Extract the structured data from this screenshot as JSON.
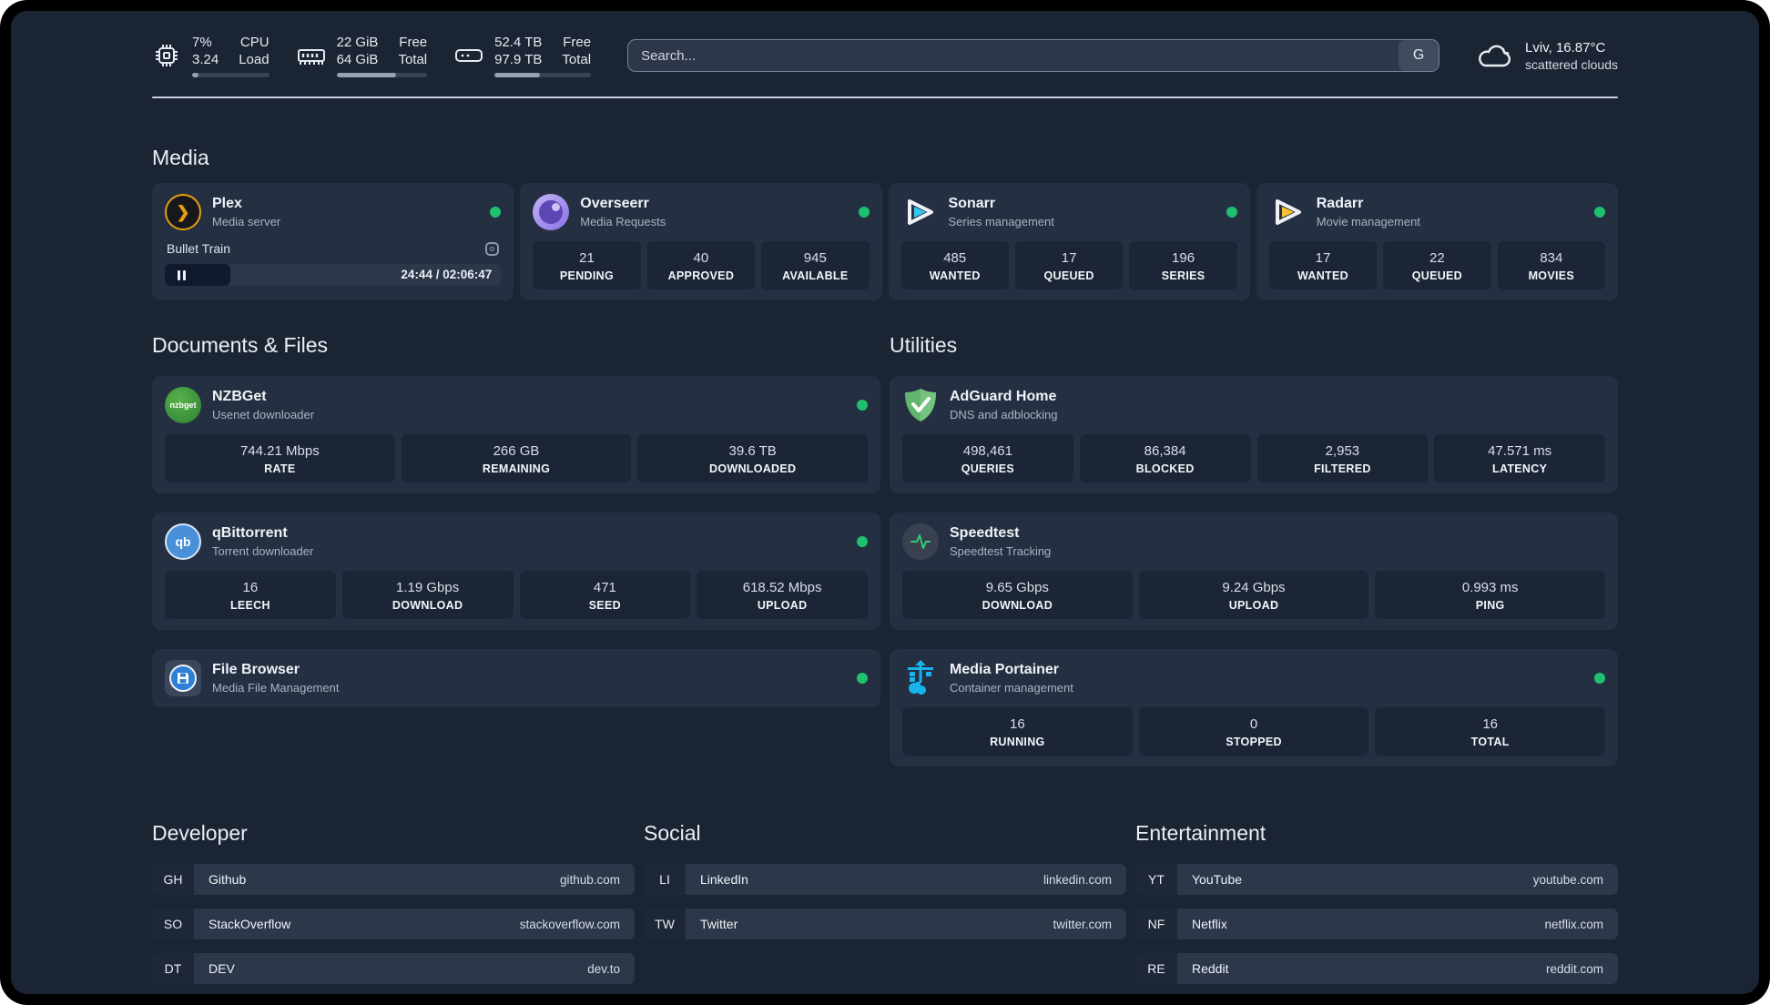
{
  "colors": {
    "online": "#1fc06e",
    "plex_accent": "#e5a00d",
    "sonarr_accent": "#35c5f4",
    "radarr_accent": "#ffc230",
    "portainer_accent": "#18b3e8",
    "speedtest_accent": "#2ecc71"
  },
  "header": {
    "metrics": [
      {
        "icon": "cpu-icon",
        "value1": "7%",
        "value2": "3.24",
        "label1": "CPU",
        "label2": "Load",
        "progress_pct": 8
      },
      {
        "icon": "ram-icon",
        "value1": "22 GiB",
        "value2": "64 GiB",
        "label1": "Free",
        "label2": "Total",
        "progress_pct": 66
      },
      {
        "icon": "disk-icon",
        "value1": "52.4 TB",
        "value2": "97.9 TB",
        "label1": "Free",
        "label2": "Total",
        "progress_pct": 47
      }
    ],
    "search": {
      "placeholder": "Search...",
      "button_label": "G"
    },
    "weather": {
      "icon": "cloud-icon",
      "line1": "Lviv, 16.87°C",
      "line2": "scattered clouds"
    }
  },
  "media": {
    "title": "Media",
    "plex": {
      "name": "Plex",
      "subtitle": "Media server",
      "now_playing": {
        "title": "Bullet Train",
        "time": "24:44 / 02:06:47",
        "progress_pct": 19.5
      }
    },
    "overseerr": {
      "name": "Overseerr",
      "subtitle": "Media Requests",
      "stats": [
        {
          "value": "21",
          "label": "PENDING"
        },
        {
          "value": "40",
          "label": "APPROVED"
        },
        {
          "value": "945",
          "label": "AVAILABLE"
        }
      ]
    },
    "sonarr": {
      "name": "Sonarr",
      "subtitle": "Series management",
      "stats": [
        {
          "value": "485",
          "label": "WANTED"
        },
        {
          "value": "17",
          "label": "QUEUED"
        },
        {
          "value": "196",
          "label": "SERIES"
        }
      ]
    },
    "radarr": {
      "name": "Radarr",
      "subtitle": "Movie management",
      "stats": [
        {
          "value": "17",
          "label": "WANTED"
        },
        {
          "value": "22",
          "label": "QUEUED"
        },
        {
          "value": "834",
          "label": "MOVIES"
        }
      ]
    }
  },
  "documents": {
    "title": "Documents & Files",
    "nzbget": {
      "name": "NZBGet",
      "subtitle": "Usenet downloader",
      "icon_label": "nzbget",
      "stats": [
        {
          "value": "744.21 Mbps",
          "label": "RATE"
        },
        {
          "value": "266 GB",
          "label": "REMAINING"
        },
        {
          "value": "39.6 TB",
          "label": "DOWNLOADED"
        }
      ]
    },
    "qbittorrent": {
      "name": "qBittorrent",
      "subtitle": "Torrent downloader",
      "icon_label": "qb",
      "stats": [
        {
          "value": "16",
          "label": "LEECH"
        },
        {
          "value": "1.19 Gbps",
          "label": "DOWNLOAD"
        },
        {
          "value": "471",
          "label": "SEED"
        },
        {
          "value": "618.52 Mbps",
          "label": "UPLOAD"
        }
      ]
    },
    "filebrowser": {
      "name": "File Browser",
      "subtitle": "Media File Management"
    }
  },
  "utilities": {
    "title": "Utilities",
    "adguard": {
      "name": "AdGuard Home",
      "subtitle": "DNS and adblocking",
      "stats": [
        {
          "value": "498,461",
          "label": "QUERIES"
        },
        {
          "value": "86,384",
          "label": "BLOCKED"
        },
        {
          "value": "2,953",
          "label": "FILTERED"
        },
        {
          "value": "47.571 ms",
          "label": "LATENCY"
        }
      ]
    },
    "speedtest": {
      "name": "Speedtest",
      "subtitle": "Speedtest Tracking",
      "stats": [
        {
          "value": "9.65 Gbps",
          "label": "DOWNLOAD"
        },
        {
          "value": "9.24 Gbps",
          "label": "UPLOAD"
        },
        {
          "value": "0.993 ms",
          "label": "PING"
        }
      ]
    },
    "portainer": {
      "name": "Media Portainer",
      "subtitle": "Container management",
      "stats": [
        {
          "value": "16",
          "label": "RUNNING"
        },
        {
          "value": "0",
          "label": "STOPPED"
        },
        {
          "value": "16",
          "label": "TOTAL"
        }
      ]
    }
  },
  "links": {
    "developer": {
      "title": "Developer",
      "items": [
        {
          "tag": "GH",
          "name": "Github",
          "url": "github.com"
        },
        {
          "tag": "SO",
          "name": "StackOverflow",
          "url": "stackoverflow.com"
        },
        {
          "tag": "DT",
          "name": "DEV",
          "url": "dev.to"
        }
      ]
    },
    "social": {
      "title": "Social",
      "items": [
        {
          "tag": "LI",
          "name": "LinkedIn",
          "url": "linkedin.com"
        },
        {
          "tag": "TW",
          "name": "Twitter",
          "url": "twitter.com"
        }
      ]
    },
    "entertainment": {
      "title": "Entertainment",
      "items": [
        {
          "tag": "YT",
          "name": "YouTube",
          "url": "youtube.com"
        },
        {
          "tag": "NF",
          "name": "Netflix",
          "url": "netflix.com"
        },
        {
          "tag": "RE",
          "name": "Reddit",
          "url": "reddit.com"
        }
      ]
    }
  }
}
